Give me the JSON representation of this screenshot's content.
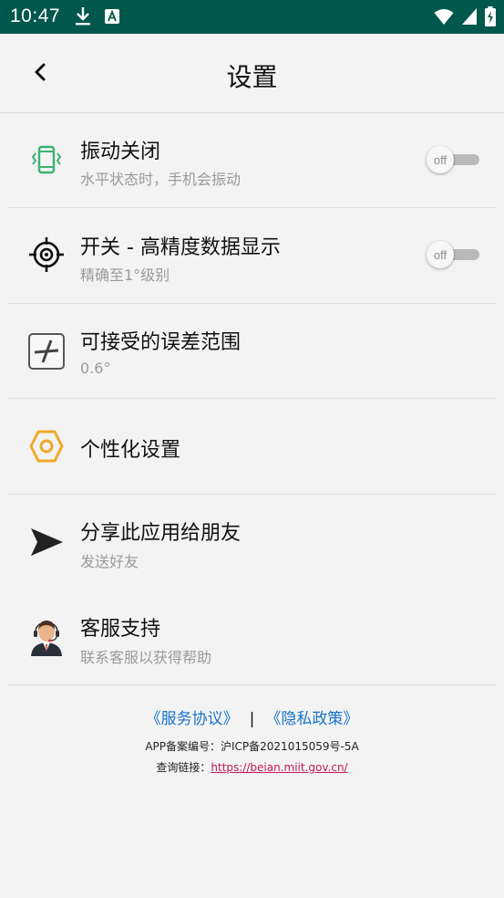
{
  "status_bar": {
    "time": "10:47"
  },
  "header": {
    "title": "设置"
  },
  "settings": {
    "vibration": {
      "title": "振动关闭",
      "subtitle": "水平状态时，手机会振动",
      "toggle_label": "off"
    },
    "precision": {
      "title": "开关 - 高精度数据显示",
      "subtitle": "精确至1°级别",
      "toggle_label": "off"
    },
    "tolerance": {
      "title": "可接受的误差范围",
      "subtitle": "0.6°"
    },
    "personalize": {
      "title": "个性化设置"
    },
    "share": {
      "title": "分享此应用给朋友",
      "subtitle": "发送好友"
    },
    "support": {
      "title": "客服支持",
      "subtitle": "联系客服以获得帮助"
    }
  },
  "footer": {
    "service_agreement": "《服务协议》",
    "separator": "|",
    "privacy_policy": "《隐私政策》",
    "icp_label": "APP备案编号：",
    "icp_number": "沪ICP备2021015059号-5A",
    "query_label": "查询链接：",
    "query_url": "https://beian.miit.gov.cn/"
  },
  "colors": {
    "status_bar": "#00574b",
    "link": "#1a73c8",
    "url": "#c2185b",
    "vibration_icon": "#3cb371",
    "personalize_icon": "#f0a92a"
  }
}
